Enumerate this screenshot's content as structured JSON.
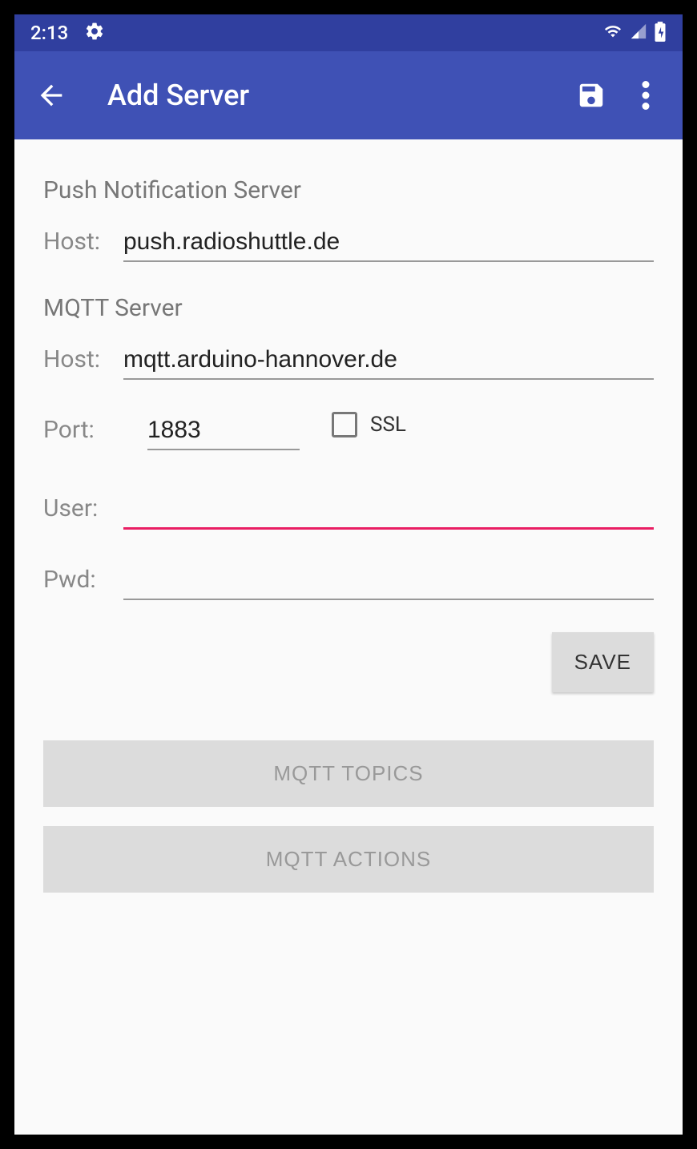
{
  "statusBar": {
    "time": "2:13"
  },
  "appBar": {
    "title": "Add Server"
  },
  "pushSection": {
    "title": "Push Notification Server",
    "hostLabel": "Host:",
    "hostValue": "push.radioshuttle.de"
  },
  "mqttSection": {
    "title": "MQTT Server",
    "hostLabel": "Host:",
    "hostValue": "mqtt.arduino-hannover.de",
    "portLabel": "Port:",
    "portValue": "1883",
    "sslLabel": "SSL",
    "sslChecked": false,
    "userLabel": "User:",
    "userValue": "",
    "pwdLabel": "Pwd:",
    "pwdValue": ""
  },
  "buttons": {
    "save": "SAVE",
    "topics": "MQTT TOPICS",
    "actions": "MQTT ACTIONS"
  },
  "colors": {
    "primary": "#3F51B5",
    "primaryDark": "#303F9F",
    "accent": "#e91e63"
  }
}
